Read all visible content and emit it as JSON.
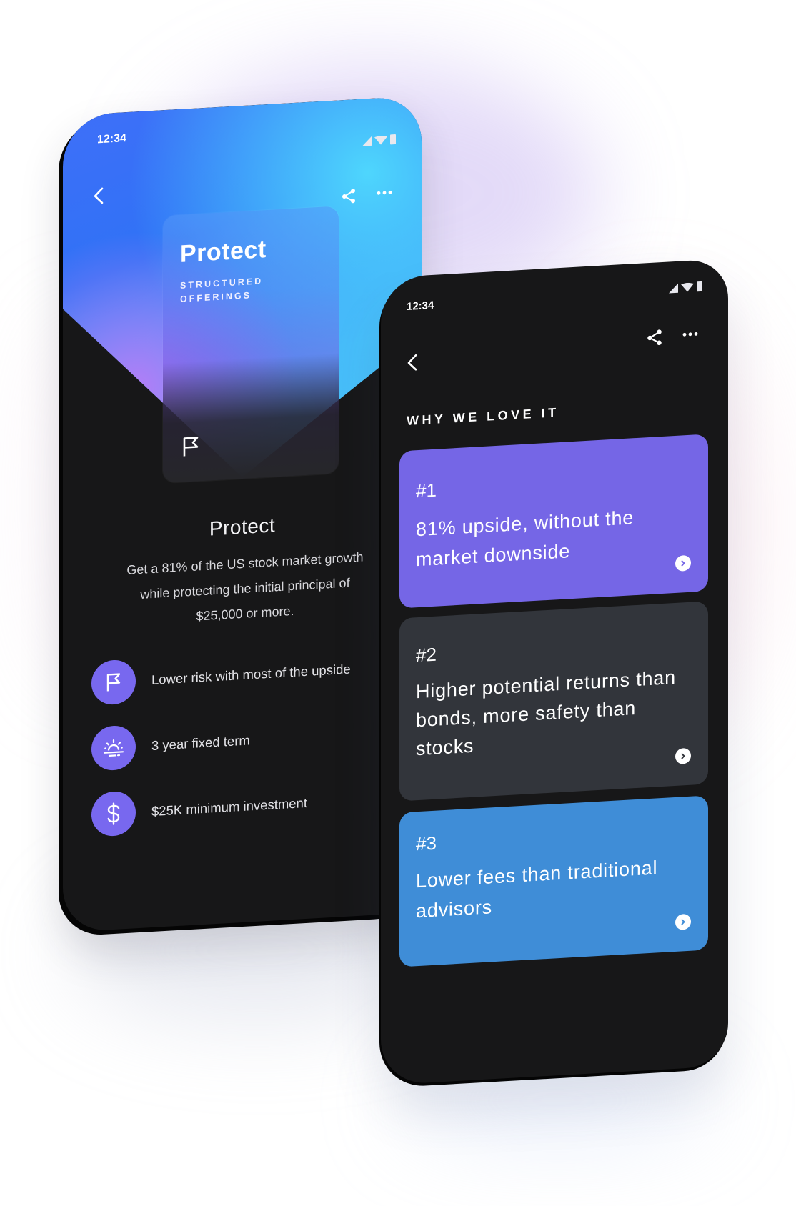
{
  "colors": {
    "accent_purple": "#7868EF",
    "card1_bg": "#7566E6",
    "card2_bg": "#32353B",
    "card3_bg": "#3F8DD7",
    "phone_bg": "#171718",
    "hero_blue": "#3072F6",
    "hero_cyan": "#4AD0FB",
    "hero_violet": "#B57CF7"
  },
  "phone_detail": {
    "status_bar": {
      "time": "12:34",
      "icons": [
        "signal-icon",
        "wifi-icon",
        "battery-icon"
      ]
    },
    "toolbar": {
      "back_icon": "chevron-left-icon",
      "share_icon": "share-icon",
      "more_icon": "more-horizontal-icon"
    },
    "product_card": {
      "title": "Protect",
      "subtitle": "STRUCTURED OFFERINGS",
      "icon": "flag-icon"
    },
    "title": "Protect",
    "description": "Get a 81% of the US stock market growth\nwhile protecting the  initial principal of\n$25,000 or more.",
    "features": [
      {
        "icon": "flag-icon",
        "label": "Lower risk with most of the upside"
      },
      {
        "icon": "sunrise-icon",
        "label": "3 year fixed term"
      },
      {
        "icon": "dollar-icon",
        "label": "$25K minimum investment"
      }
    ]
  },
  "phone_reasons": {
    "status_bar": {
      "time": "12:34",
      "icons": [
        "signal-icon",
        "wifi-icon",
        "battery-icon"
      ]
    },
    "toolbar": {
      "back_icon": "chevron-left-icon",
      "share_icon": "share-icon",
      "more_icon": "more-horizontal-icon"
    },
    "section_title": "WHY WE LOVE IT",
    "reasons": [
      {
        "number": "#1",
        "text": "81% upside, without the market downside"
      },
      {
        "number": "#2",
        "text": "Higher potential returns than bonds, more safety than stocks"
      },
      {
        "number": "#3",
        "text": "Lower fees than traditional advisors"
      }
    ]
  }
}
